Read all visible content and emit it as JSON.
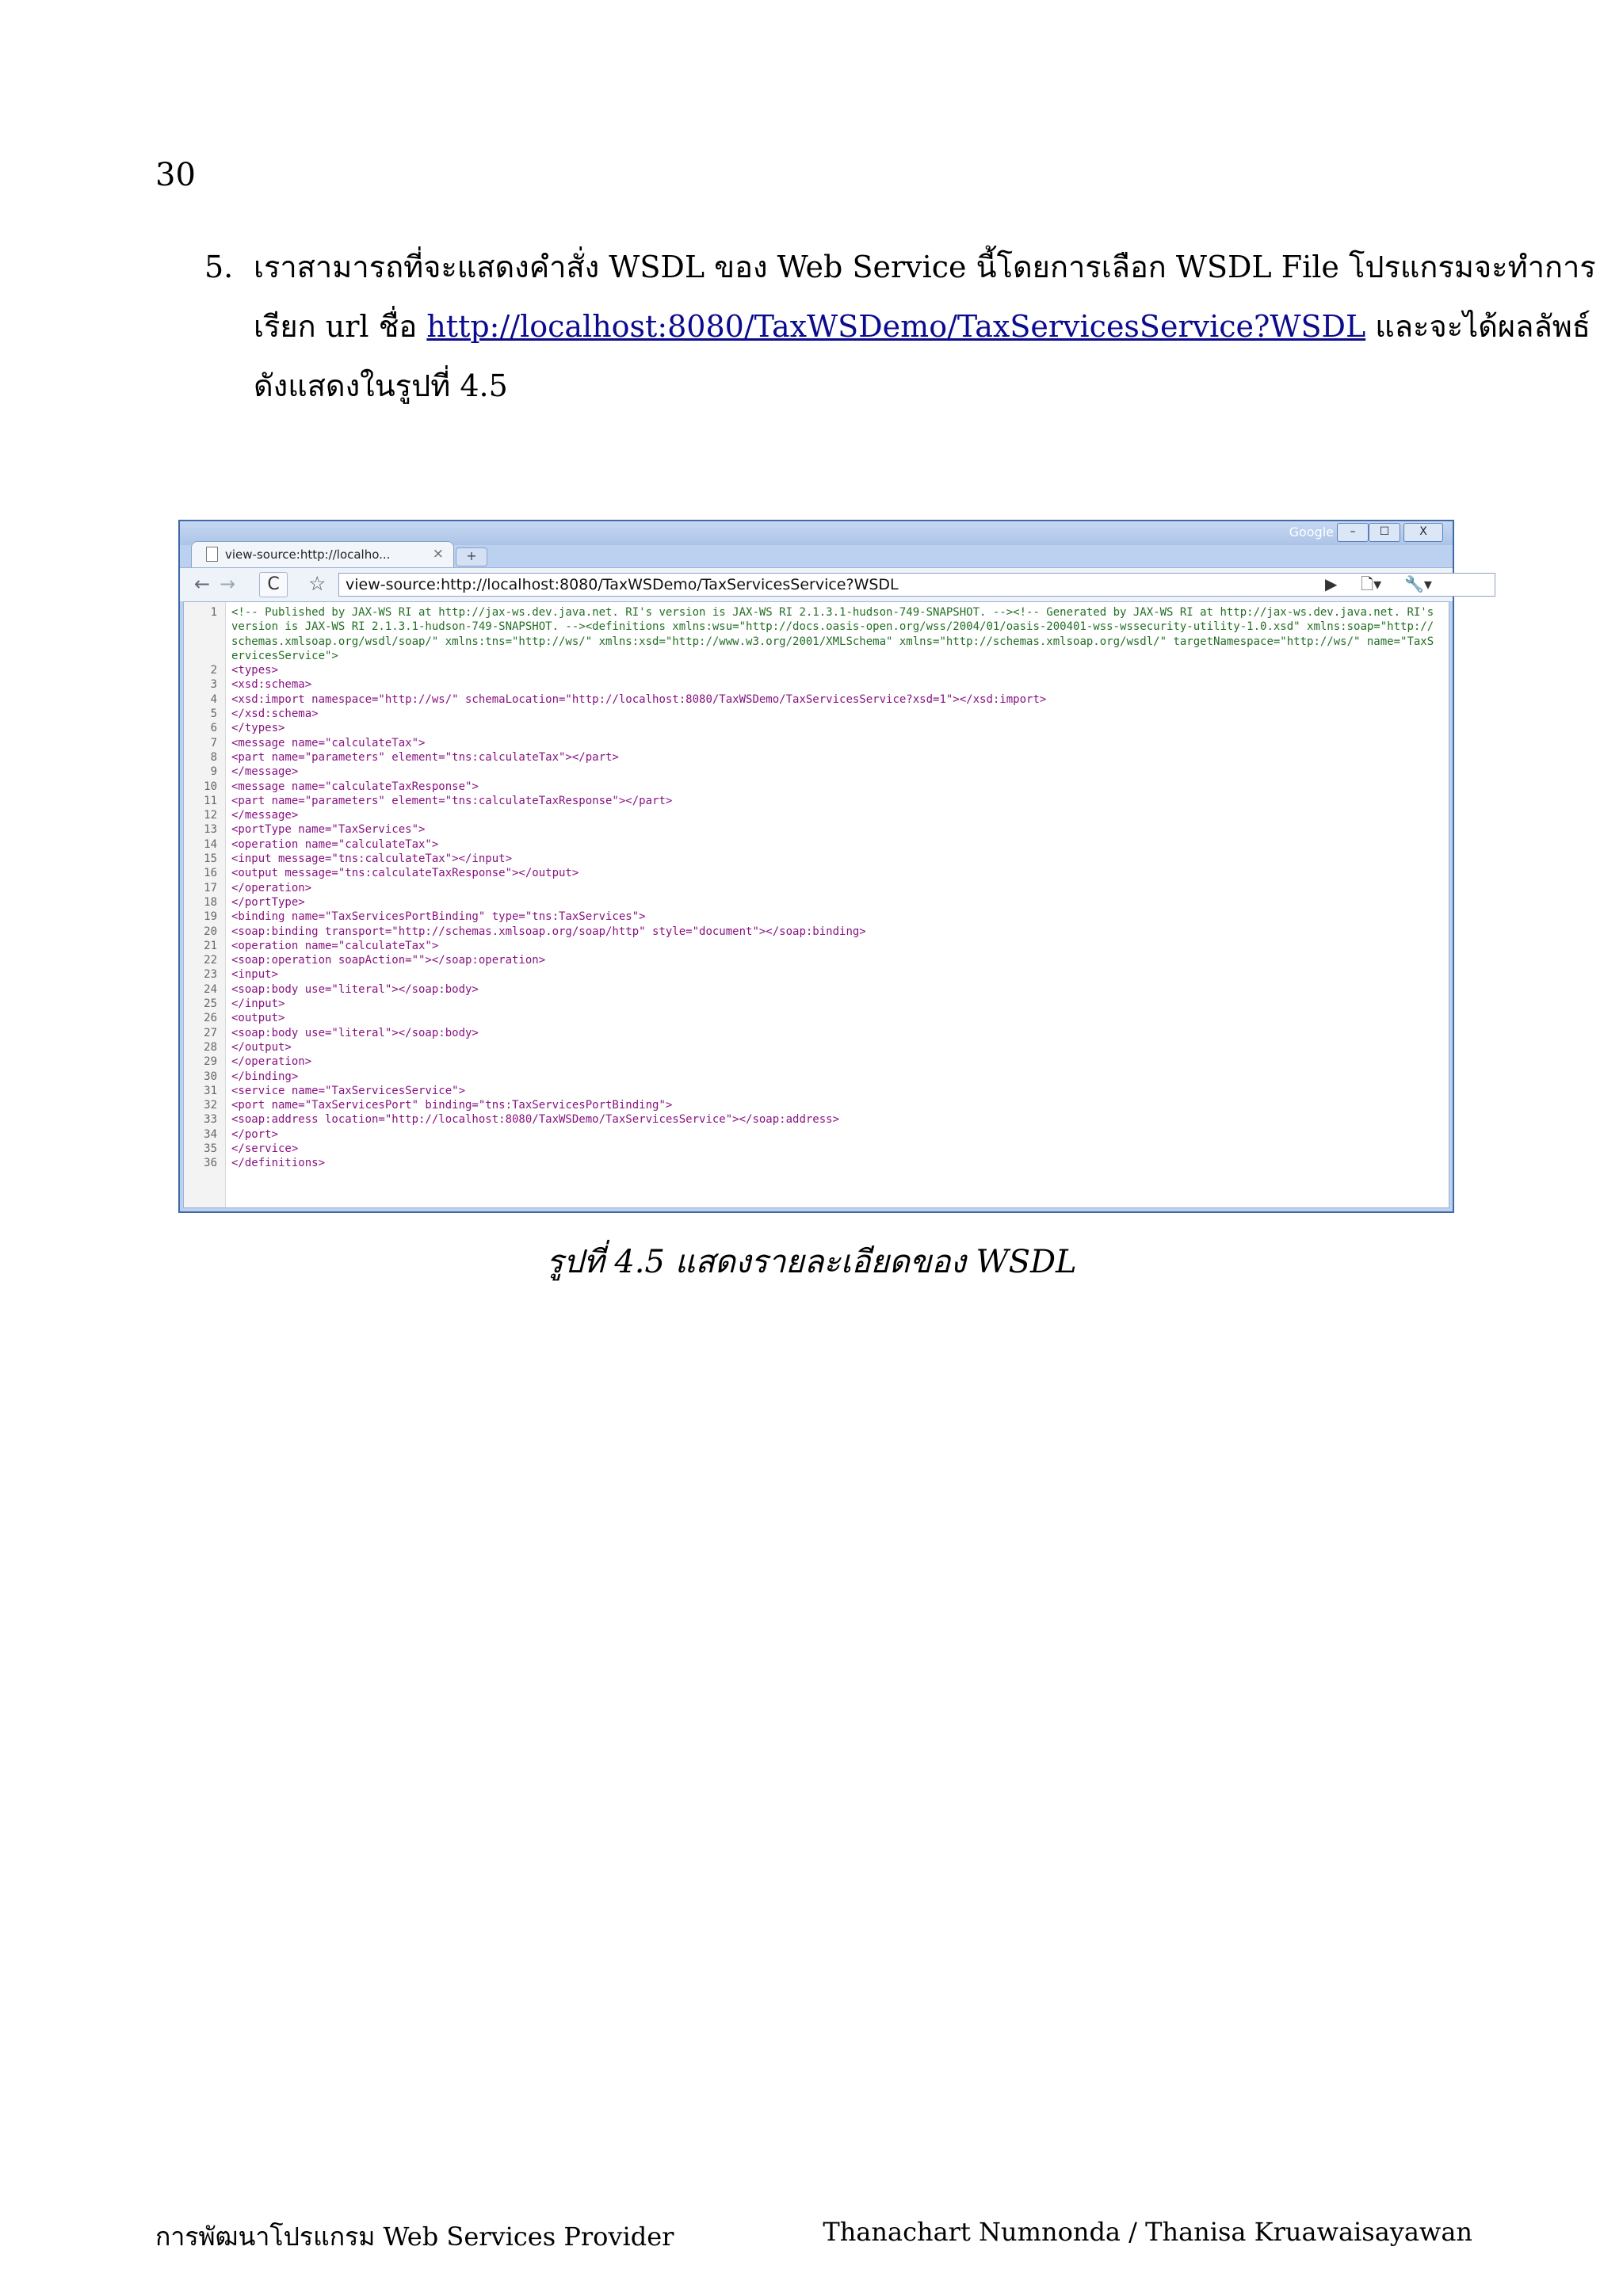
{
  "page_number": "30",
  "item": {
    "number": "5.",
    "line1": "เราสามารถที่จะแสดงคำสั่ง WSDL ของ Web Service นี้โดยการเลือก WSDL File โปรแกรมจะทำการ",
    "line2_prefix": "เรียก url ชื่อ ",
    "link": "http://localhost:8080/TaxWSDemo/TaxServicesService?WSDL",
    "line2_suffix": " และจะได้ผลลัพธ์",
    "line3": "ดังแสดงในรูปที่ 4.5"
  },
  "browser": {
    "brand": "Google",
    "window_buttons": {
      "minimize": "–",
      "maximize": "☐",
      "close": "X"
    },
    "tab_title": "view-source:http://localho...",
    "tab_close": "×",
    "new_tab": "+",
    "address": "view-source:http://localhost:8080/TaxWSDemo/TaxServicesService?WSDL",
    "icons": {
      "back": "←",
      "forward": "→",
      "reload": "C",
      "star": "☆",
      "go": "▶",
      "page_menu": "🗋▾",
      "wrench": "🔧▾"
    }
  },
  "source_lines": [
    {
      "n": "1",
      "text": "<!-- Published by JAX-WS RI at http://jax-ws.dev.java.net. RI's version is JAX-WS RI 2.1.3.1-hudson-749-SNAPSHOT. --><!-- Generated by JAX-WS RI at http://jax-ws.dev.java.net. RI's version is JAX-WS RI 2.1.3.1-hudson-749-SNAPSHOT. --><definitions xmlns:wsu=\"http://docs.oasis-open.org/wss/2004/01/oasis-200401-wss-wssecurity-utility-1.0.xsd\" xmlns:soap=\"http://schemas.xmlsoap.org/wsdl/soap/\" xmlns:tns=\"http://ws/\" xmlns:xsd=\"http://www.w3.org/2001/XMLSchema\" xmlns=\"http://schemas.xmlsoap.org/wsdl/\" targetNamespace=\"http://ws/\" name=\"TaxServicesService\">"
    },
    {
      "n": "2",
      "text": "<types>"
    },
    {
      "n": "3",
      "text": "<xsd:schema>"
    },
    {
      "n": "4",
      "text": "<xsd:import namespace=\"http://ws/\" schemaLocation=\"http://localhost:8080/TaxWSDemo/TaxServicesService?xsd=1\"></xsd:import>"
    },
    {
      "n": "5",
      "text": "</xsd:schema>"
    },
    {
      "n": "6",
      "text": "</types>"
    },
    {
      "n": "7",
      "text": "<message name=\"calculateTax\">"
    },
    {
      "n": "8",
      "text": "<part name=\"parameters\" element=\"tns:calculateTax\"></part>"
    },
    {
      "n": "9",
      "text": "</message>"
    },
    {
      "n": "10",
      "text": "<message name=\"calculateTaxResponse\">"
    },
    {
      "n": "11",
      "text": "<part name=\"parameters\" element=\"tns:calculateTaxResponse\"></part>"
    },
    {
      "n": "12",
      "text": "</message>"
    },
    {
      "n": "13",
      "text": "<portType name=\"TaxServices\">"
    },
    {
      "n": "14",
      "text": "<operation name=\"calculateTax\">"
    },
    {
      "n": "15",
      "text": "<input message=\"tns:calculateTax\"></input>"
    },
    {
      "n": "16",
      "text": "<output message=\"tns:calculateTaxResponse\"></output>"
    },
    {
      "n": "17",
      "text": "</operation>"
    },
    {
      "n": "18",
      "text": "</portType>"
    },
    {
      "n": "19",
      "text": "<binding name=\"TaxServicesPortBinding\" type=\"tns:TaxServices\">"
    },
    {
      "n": "20",
      "text": "<soap:binding transport=\"http://schemas.xmlsoap.org/soap/http\" style=\"document\"></soap:binding>"
    },
    {
      "n": "21",
      "text": "<operation name=\"calculateTax\">"
    },
    {
      "n": "22",
      "text": "<soap:operation soapAction=\"\"></soap:operation>"
    },
    {
      "n": "23",
      "text": "<input>"
    },
    {
      "n": "24",
      "text": "<soap:body use=\"literal\"></soap:body>"
    },
    {
      "n": "25",
      "text": "</input>"
    },
    {
      "n": "26",
      "text": "<output>"
    },
    {
      "n": "27",
      "text": "<soap:body use=\"literal\"></soap:body>"
    },
    {
      "n": "28",
      "text": "</output>"
    },
    {
      "n": "29",
      "text": "</operation>"
    },
    {
      "n": "30",
      "text": "</binding>"
    },
    {
      "n": "31",
      "text": "<service name=\"TaxServicesService\">"
    },
    {
      "n": "32",
      "text": "<port name=\"TaxServicesPort\" binding=\"tns:TaxServicesPortBinding\">"
    },
    {
      "n": "33",
      "text": "<soap:address location=\"http://localhost:8080/TaxWSDemo/TaxServicesService\"></soap:address>"
    },
    {
      "n": "34",
      "text": "</port>"
    },
    {
      "n": "35",
      "text": "</service>"
    },
    {
      "n": "36",
      "text": "</definitions>"
    }
  ],
  "caption": "รูปที่ 4.5 แสดงรายละเอียดของ WSDL",
  "footer": {
    "left": "การพัฒนาโปรแกรม Web Services Provider",
    "right": "Thanachart Numnonda / Thanisa Kruawaisayawan"
  }
}
